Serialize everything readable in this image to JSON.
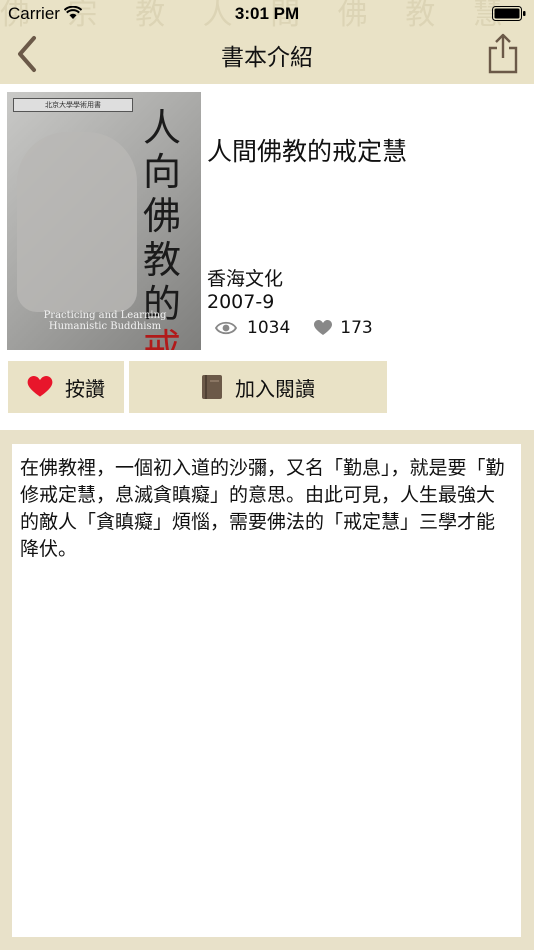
{
  "status_bar": {
    "carrier": "Carrier",
    "time": "3:01 PM"
  },
  "nav": {
    "title": "書本介紹",
    "back_icon": "chevron-left-icon",
    "share_icon": "share-icon"
  },
  "watermark": "佛 宗 教 人 間 佛 教 慧 舉 佛 佛 法 禪",
  "book": {
    "title": "人間佛教的戒定慧",
    "publisher": "香海文化",
    "date": "2007-9",
    "views": "1034",
    "likes": "173",
    "cover": {
      "label": "北京大學學術用書",
      "title_line1": "人向佛教的",
      "title_line2": "戒定慧",
      "subtitle": "Practicing and Learning Humanistic Buddhism"
    }
  },
  "actions": {
    "like_label": "按讚",
    "read_label": "加入閱讀"
  },
  "description": "在佛教裡，一個初入道的沙彌，又名「勤息」，就是要「勤修戒定慧，息滅貪瞋癡」的意思。由此可見，人生最強大的敵人「貪瞋癡」煩惱，需要佛法的「戒定慧」三學才能降伏。",
  "colors": {
    "header_bg": "#e9e2c6",
    "heart": "#e8162b",
    "book_icon": "#6b5948",
    "accent": "#6b5948"
  }
}
